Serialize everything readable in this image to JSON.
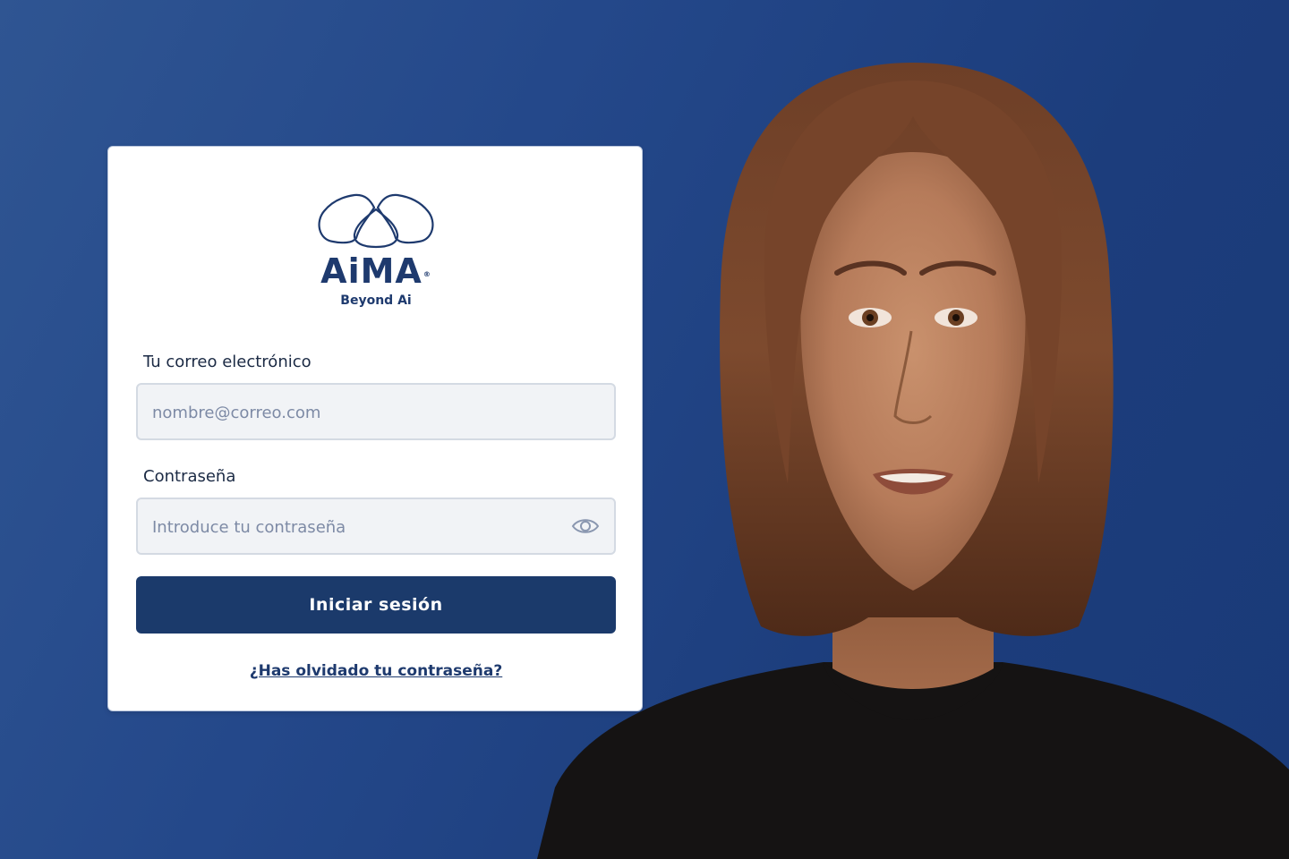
{
  "brand": {
    "name": "AiMA",
    "registered_mark": "®",
    "tagline": "Beyond Ai",
    "logo_icon": "three-cloud-outline-icon",
    "color": "#1e3a6e"
  },
  "login_form": {
    "email_label": "Tu correo electrónico",
    "email_placeholder": "nombre@correo.com",
    "email_value": "",
    "password_label": "Contraseña",
    "password_placeholder": "Introduce tu contraseña",
    "password_value": "",
    "password_toggle_icon": "eye-icon",
    "submit_label": "Iniciar sesión",
    "forgot_label": "¿Has olvidado tu contraseña?"
  },
  "theme": {
    "background": "#24488a",
    "button": "#1b3a6b",
    "input_bg": "#f1f3f6"
  },
  "illustration": {
    "subject": "avatar-portrait"
  }
}
